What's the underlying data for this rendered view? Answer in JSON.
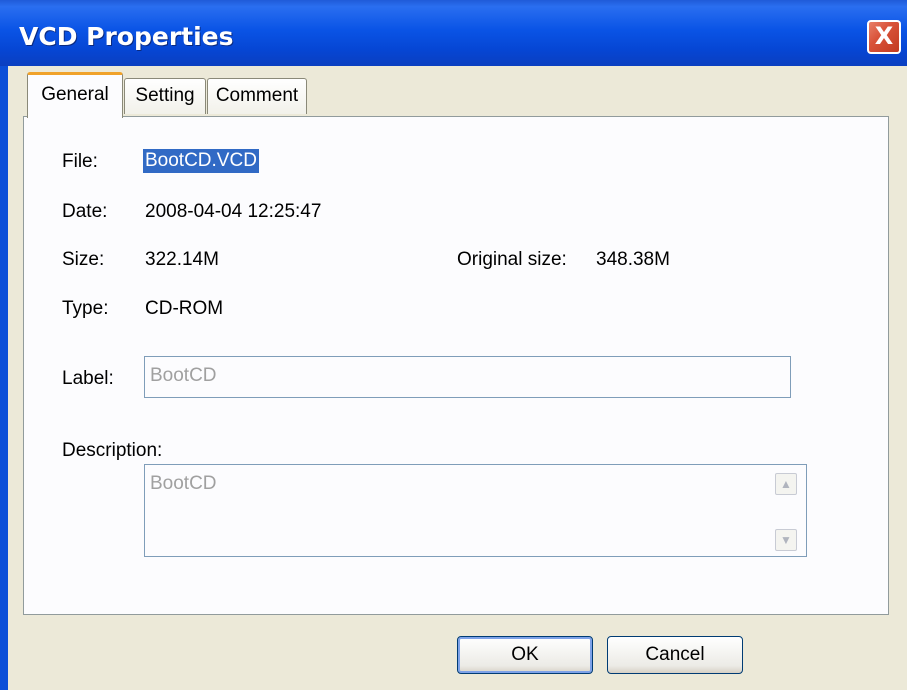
{
  "window": {
    "title": "VCD Properties",
    "close_glyph": "X"
  },
  "tabs": [
    {
      "label": "General",
      "active": true
    },
    {
      "label": "Setting",
      "active": false
    },
    {
      "label": "Comment",
      "active": false
    }
  ],
  "general": {
    "file_label": "File:",
    "file_value": "BootCD.VCD",
    "date_label": "Date:",
    "date_value": "2008-04-04 12:25:47",
    "size_label": "Size:",
    "size_value": "322.14M",
    "original_size_label": "Original size:",
    "original_size_value": "348.38M",
    "type_label": "Type:",
    "type_value": "CD-ROM",
    "label_label": "Label:",
    "label_value": "BootCD",
    "description_label": "Description:",
    "description_value": "BootCD"
  },
  "buttons": {
    "ok": "OK",
    "cancel": "Cancel"
  },
  "colors": {
    "title_bar": "#0a54e6",
    "dialog_bg": "#ece9d8",
    "selection": "#316ac5",
    "close": "#d9533a"
  },
  "icons": {
    "scroll_up": "chevron-up-icon",
    "scroll_down": "chevron-down-icon"
  }
}
